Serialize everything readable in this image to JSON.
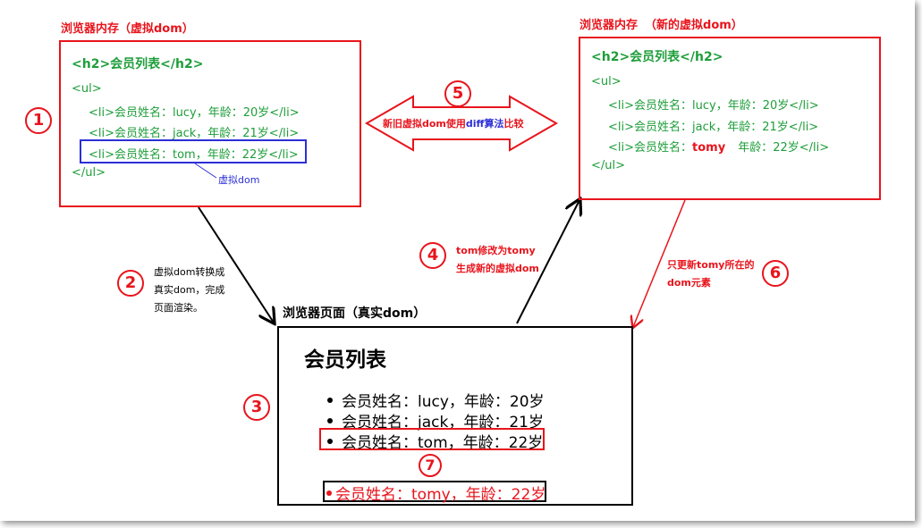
{
  "left_memory": {
    "title": "浏览器内存（虚拟dom）",
    "code_h2": "<h2>会员列表</h2>",
    "ul_open": "<ul>",
    "items": [
      "<li>会员姓名：lucy，年龄：20岁</li>",
      "<li>会员姓名：jack，年龄：21岁</li>",
      "<li>会员姓名：tom，年龄：22岁</li>"
    ],
    "ul_close": "</ul>",
    "vdom_label": "虚拟dom"
  },
  "right_memory": {
    "title": "浏览器内存",
    "title_sub": "（新的虚拟dom）",
    "code_h2": "<h2>会员列表</h2>",
    "ul_open": "<ul>",
    "items": [
      "<li>会员姓名：lucy，年龄：20岁</li>",
      "<li>会员姓名：jack，年龄：21岁</li>"
    ],
    "item3_prefix": "<li>会员姓名：",
    "item3_changed": "tomy",
    "item3_suffix": "年龄：22岁</li>",
    "ul_close": "</ul>"
  },
  "compare": {
    "prefix": "新旧虚拟dom使用",
    "algo": "diff算法",
    "suffix": "比较"
  },
  "step2": {
    "lines": [
      "虚拟dom转换成",
      "真实dom，完成",
      "页面渲染。"
    ]
  },
  "step4": {
    "lines": [
      "tom修改为tomy",
      "生成新的虚拟dom"
    ]
  },
  "step6": {
    "lines": [
      "只更新tomy所在的",
      "dom元素"
    ]
  },
  "page": {
    "title": "浏览器页面（真实dom）",
    "heading": "会员列表",
    "items": [
      "会员姓名：lucy，年龄：20岁",
      "会员姓名：jack，年龄：21岁",
      "会员姓名：tom，年龄：22岁"
    ],
    "updated_item": "会员姓名：tomy，年龄：22岁"
  },
  "numbers": [
    "1",
    "2",
    "3",
    "4",
    "5",
    "6",
    "7"
  ],
  "colors": {
    "red": "#e8141c",
    "green": "#1e9e3a",
    "blue": "#2b2fd6",
    "black": "#000000"
  }
}
